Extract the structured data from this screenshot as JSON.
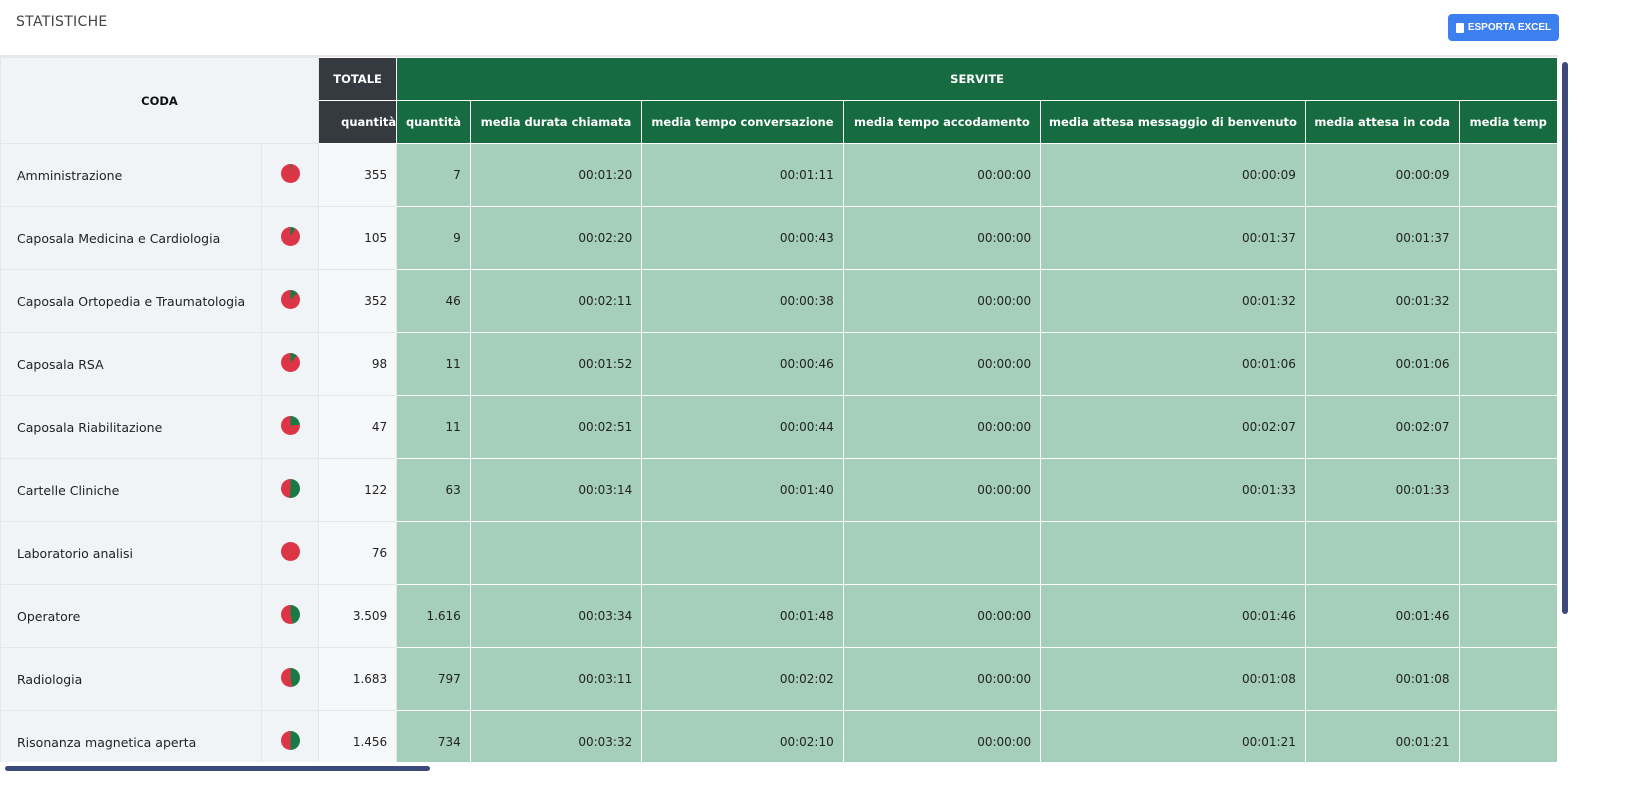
{
  "header": {
    "title": "STATISTICHE",
    "export_label": "ESPORTA EXCEL"
  },
  "colors": {
    "served": "#1a7a45",
    "unserved": "#dc3545"
  },
  "table": {
    "coda_header": "CODA",
    "totale_header": "TOTALE",
    "servite_header": "SERVITE",
    "sub_headers": [
      "quantità",
      "quantità",
      "media durata chiamata",
      "media tempo conversazione",
      "media tempo accodamento",
      "media attesa messaggio di benvenuto",
      "media attesa in coda",
      "media temp"
    ],
    "rows": [
      {
        "name": "Amministrazione",
        "total": "355",
        "cells": [
          "7",
          "00:01:20",
          "00:01:11",
          "00:00:00",
          "00:00:09",
          "00:00:09",
          ""
        ]
      },
      {
        "name": "Caposala Medicina e Cardiologia",
        "total": "105",
        "cells": [
          "9",
          "00:02:20",
          "00:00:43",
          "00:00:00",
          "00:01:37",
          "00:01:37",
          ""
        ]
      },
      {
        "name": "Caposala Ortopedia e Traumatologia",
        "total": "352",
        "cells": [
          "46",
          "00:02:11",
          "00:00:38",
          "00:00:00",
          "00:01:32",
          "00:01:32",
          ""
        ]
      },
      {
        "name": "Caposala RSA",
        "total": "98",
        "cells": [
          "11",
          "00:01:52",
          "00:00:46",
          "00:00:00",
          "00:01:06",
          "00:01:06",
          ""
        ]
      },
      {
        "name": "Caposala Riabilitazione",
        "total": "47",
        "cells": [
          "11",
          "00:02:51",
          "00:00:44",
          "00:00:00",
          "00:02:07",
          "00:02:07",
          ""
        ]
      },
      {
        "name": "Cartelle Cliniche",
        "total": "122",
        "cells": [
          "63",
          "00:03:14",
          "00:01:40",
          "00:00:00",
          "00:01:33",
          "00:01:33",
          ""
        ]
      },
      {
        "name": "Laboratorio analisi",
        "total": "76",
        "cells": [
          "",
          "",
          "",
          "",
          "",
          "",
          ""
        ]
      },
      {
        "name": "Operatore",
        "total": "3.509",
        "cells": [
          "1.616",
          "00:03:34",
          "00:01:48",
          "00:00:00",
          "00:01:46",
          "00:01:46",
          ""
        ]
      },
      {
        "name": "Radiologia",
        "total": "1.683",
        "cells": [
          "797",
          "00:03:11",
          "00:02:02",
          "00:00:00",
          "00:01:08",
          "00:01:08",
          ""
        ]
      },
      {
        "name": "Risonanza magnetica aperta",
        "total": "1.456",
        "cells": [
          "734",
          "00:03:32",
          "00:02:10",
          "00:00:00",
          "00:01:21",
          "00:01:21",
          ""
        ]
      }
    ]
  }
}
